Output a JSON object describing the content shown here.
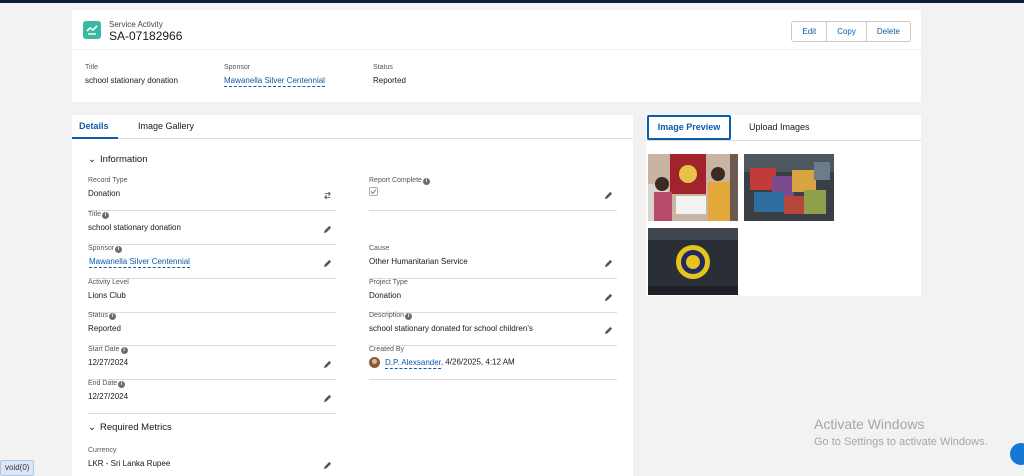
{
  "header": {
    "object_type": "Service Activity",
    "record_id": "SA-07182966",
    "icon": "service-activity-icon",
    "buttons": {
      "edit": "Edit",
      "copy": "Copy",
      "delete": "Delete"
    },
    "highlights": {
      "title_label": "Title",
      "title_value": "school stationary donation",
      "sponsor_label": "Sponsor",
      "sponsor_value": "Mawanella Silver Centennial",
      "status_label": "Status",
      "status_value": "Reported"
    }
  },
  "left_tabs": {
    "details": "Details",
    "gallery": "Image Gallery"
  },
  "sections": {
    "information": "Information",
    "required_metrics": "Required Metrics"
  },
  "fields": {
    "record_type": {
      "label": "Record Type",
      "value": "Donation"
    },
    "report_complete": {
      "label": "Report Complete",
      "checked": true
    },
    "title": {
      "label": "Title",
      "value": "school stationary donation"
    },
    "sponsor": {
      "label": "Sponsor",
      "value": "Mawanella Silver Centennial"
    },
    "cause": {
      "label": "Cause",
      "value": "Other Humanitarian Service"
    },
    "activity_level": {
      "label": "Activity Level",
      "value": "Lions Club"
    },
    "project_type": {
      "label": "Project Type",
      "value": "Donation"
    },
    "status": {
      "label": "Status",
      "value": "Reported"
    },
    "description": {
      "label": "Description",
      "value": "school stationary donated for school children's"
    },
    "start_date": {
      "label": "Start Date",
      "value": "12/27/2024"
    },
    "created_by": {
      "label": "Created By",
      "user": "D.P. Alexsander",
      "date": ", 4/26/2025, 4:12 AM"
    },
    "end_date": {
      "label": "End Date",
      "value": "12/27/2024"
    },
    "currency": {
      "label": "Currency",
      "value": "LKR - Sri Lanka Rupee"
    }
  },
  "right_tabs": {
    "preview": "Image Preview",
    "upload": "Upload Images"
  },
  "watermark": {
    "line1": "Activate Windows",
    "line2": "Go to Settings to activate Windows."
  },
  "status_bar": {
    "text": "void(0)"
  },
  "colors": {
    "brand": "#0b5cab",
    "icon_teal": "#3bb8a4",
    "topbar": "#0a1b3d"
  }
}
